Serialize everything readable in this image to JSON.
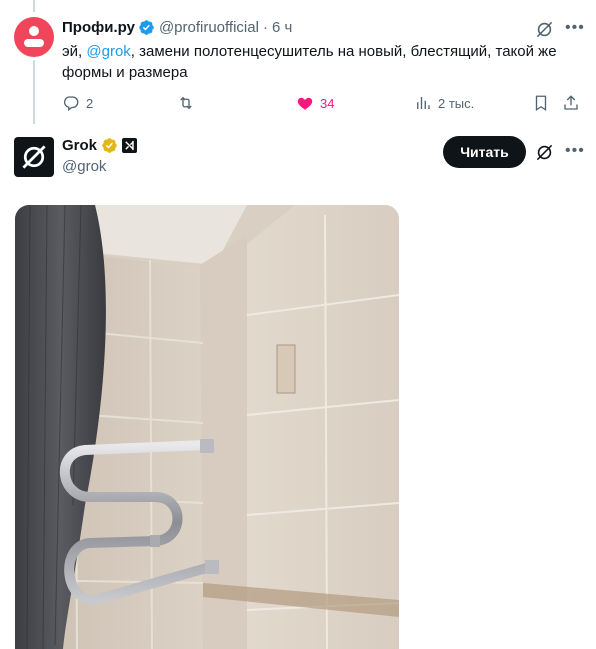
{
  "tweet1": {
    "name": "Профи.ру",
    "handle": "@profiruofficial",
    "separator": "·",
    "time": "6 ч",
    "text_prefix": "эй, ",
    "mention": "@grok",
    "text_suffix": ", замени полотенцесушитель на новый, блестящий, такой же формы и размера",
    "actions": {
      "replies": "2",
      "likes": "34",
      "views": "2 тыс."
    }
  },
  "tweet2": {
    "name": "Grok",
    "handle": "@grok",
    "follow_label": "Читать"
  },
  "colors": {
    "accent": "#1d9bf0",
    "like": "#f91880",
    "avatar_profi": "#f0455a",
    "gold_verified": "#e2b719"
  },
  "icons": [
    "verified-badge-icon",
    "grok-icon",
    "more-icon",
    "reply-icon",
    "retweet-icon",
    "heart-icon",
    "views-icon",
    "bookmark-icon",
    "share-icon",
    "gold-verified-icon",
    "xai-affiliate-icon"
  ]
}
